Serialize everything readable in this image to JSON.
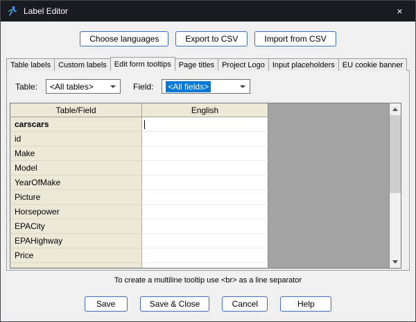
{
  "colors": {
    "accent": "#0078d7",
    "titlebar_bg": "#1a1a23",
    "grid_header_bg": "#ece9d8",
    "grid_empty_area": "#a3a3a3",
    "button_border": "#3f6fb4"
  },
  "window": {
    "title": "Label Editor"
  },
  "icons": {
    "close": "×"
  },
  "toolbar": {
    "buttons": [
      "Choose languages",
      "Export to CSV",
      "Import from CSV"
    ]
  },
  "tabs": [
    "Table labels",
    "Custom labels",
    "Edit form tooltips",
    "Page titles",
    "Project Logo",
    "Input placeholders",
    "EU cookie banner"
  ],
  "active_tab": "Edit form tooltips",
  "filters": {
    "table_label": "Table:",
    "table_value": "<All tables>",
    "field_label": "Field:",
    "field_value": "<All fields>"
  },
  "grid": {
    "columns": [
      "Table/Field",
      "English"
    ],
    "rows": [
      {
        "field": "carscars",
        "english": ""
      },
      {
        "field": "id",
        "english": ""
      },
      {
        "field": "Make",
        "english": ""
      },
      {
        "field": "Model",
        "english": ""
      },
      {
        "field": "YearOfMake",
        "english": ""
      },
      {
        "field": "Picture",
        "english": ""
      },
      {
        "field": "Horsepower",
        "english": ""
      },
      {
        "field": "EPACity",
        "english": ""
      },
      {
        "field": "EPAHighway",
        "english": ""
      },
      {
        "field": "Price",
        "english": ""
      }
    ]
  },
  "hint": "To create a multiline tooltip use <br> as a line separator",
  "footer": {
    "buttons": [
      "Save",
      "Save & Close",
      "Cancel",
      "Help"
    ]
  }
}
